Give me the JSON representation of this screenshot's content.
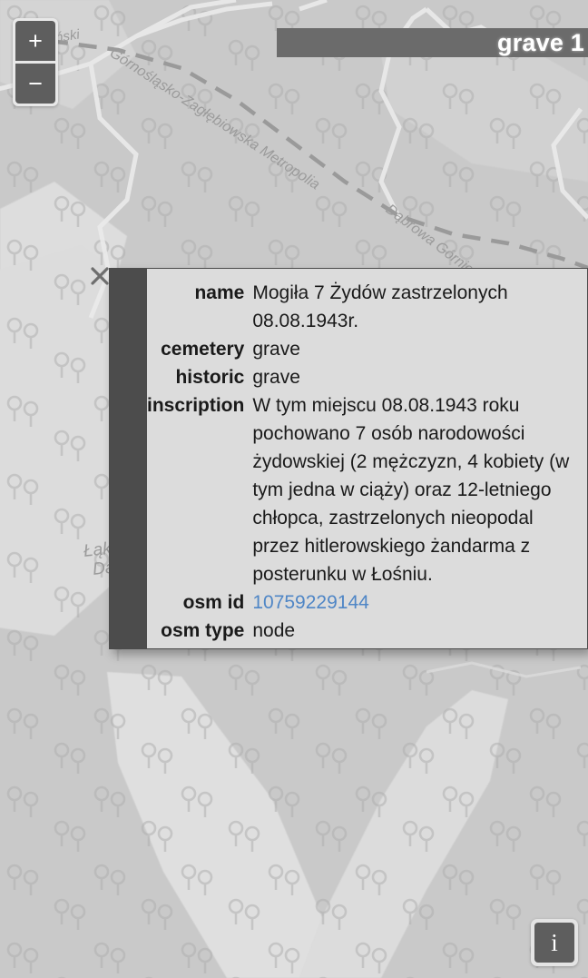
{
  "header": {
    "title": "grave 1"
  },
  "zoom_controls": {
    "zoom_in_label": "+",
    "zoom_out_label": "−"
  },
  "info_button": {
    "label": "i"
  },
  "popup": {
    "close_label": "×",
    "rows": [
      {
        "key": "name",
        "value": "Mogiła 7 Żydów zastrzelonych 08.08.1943r.",
        "link": false
      },
      {
        "key": "cemetery",
        "value": "grave",
        "link": false
      },
      {
        "key": "historic",
        "value": "grave",
        "link": false
      },
      {
        "key": "inscription",
        "value": "W tym miejscu 08.08.1943 roku pochowano 7 osób narodowości żydowskiej (2 mężczyzn, 4 kobiety (w tym jedna w ciąży) oraz 12-letniego chłopca, zastrzelonych nieopodal przez hitlerowskiego żandarma z posterunku w Łośniu.",
        "link": false
      },
      {
        "key": "osm id",
        "value": "10759229144",
        "link": true
      },
      {
        "key": "osm type",
        "value": "node",
        "link": false
      }
    ]
  },
  "map": {
    "labels": {
      "gdanski": "ciański",
      "metropolia": "Górnośląsko-Zagłębiowska Metropolia",
      "dabrowa_gornicza": "Dąbrowa Górnicza",
      "laki_line1": "Łąki Dolnej",
      "laki_line2": "Dąbrowy"
    }
  },
  "colors": {
    "map_background": "#c9c9c9",
    "map_light_area": "#dedede",
    "popup_background": "#dcdcdc",
    "popup_gutter": "#4c4c4c",
    "title_bar": "#6b6b6b",
    "control_button": "#5e5e5e",
    "link": "#4f86c6"
  }
}
